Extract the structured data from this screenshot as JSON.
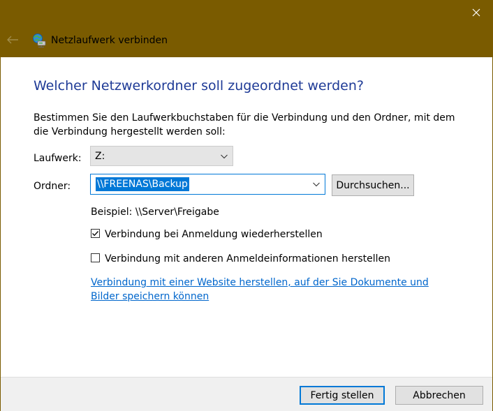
{
  "window": {
    "title": "Netzlaufwerk verbinden",
    "accent_color": "#7a5b00"
  },
  "icons": {
    "close": "close-icon",
    "back": "back-arrow-icon",
    "app": "network-drive-icon",
    "dropdown": "chevron-down-icon",
    "check": "checkmark-icon"
  },
  "heading": "Welcher Netzwerkordner soll zugeordnet werden?",
  "description": "Bestimmen Sie den Laufwerkbuchstaben für die Verbindung und den Ordner, mit dem die Verbindung hergestellt werden soll:",
  "drive": {
    "label": "Laufwerk:",
    "value": "Z:"
  },
  "folder": {
    "label": "Ordner:",
    "value": "\\\\FREENAS\\Backup",
    "browse_label": "Durchsuchen..."
  },
  "example": "Beispiel: \\\\Server\\Freigabe",
  "options": [
    {
      "label": "Verbindung bei Anmeldung wiederherstellen",
      "checked": true
    },
    {
      "label": "Verbindung mit anderen Anmeldeinformationen herstellen",
      "checked": false
    }
  ],
  "link_text": "Verbindung mit einer Website herstellen, auf der Sie Dokumente und Bilder speichern können",
  "footer": {
    "finish_label": "Fertig stellen",
    "cancel_label": "Abbrechen"
  }
}
